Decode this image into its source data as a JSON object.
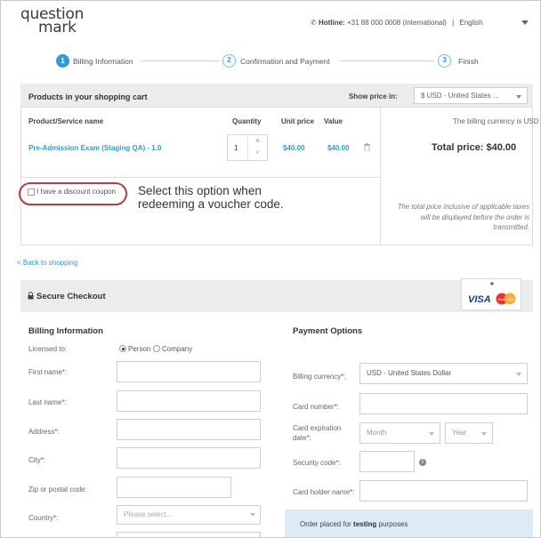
{
  "header": {
    "logo_line1": "question",
    "logo_line2": "mark",
    "hotline_label": "Hotline:",
    "hotline_number": "+31 88 000 0008 (International)",
    "separator": "|",
    "language": "English"
  },
  "steps": [
    {
      "number": "1",
      "label": "Billing Information"
    },
    {
      "number": "2",
      "label": "Confirmation and Payment"
    },
    {
      "number": "3",
      "label": "Finish"
    }
  ],
  "cart": {
    "title": "Products in your shopping cart",
    "show_price_label": "Show price in:",
    "currency_select": "$ USD - United States ...",
    "columns": {
      "product": "Product/Service name",
      "quantity": "Quantity",
      "unit_price": "Unit price",
      "value": "Value"
    },
    "item": {
      "name": "Pre-Admission Exam (Staging QA) - 1.0",
      "quantity": "1",
      "unit_price": "$40.00",
      "value": "$40.00"
    },
    "billing_currency_note": "The billing currency is USD ($)",
    "total_price": "Total price: $40.00",
    "coupon_label": "I have a discount coupon",
    "annotation": "Select this option when redeeming a voucher code.",
    "tax_note": "The total price inclusive of applicable taxes will be displayed before the order is transmitted."
  },
  "back_link": "< Back to shopping",
  "checkout": {
    "title": "Secure Checkout",
    "card_logos": {
      "visa": "VISA",
      "mastercard": "MasterCard"
    }
  },
  "billing": {
    "heading": "Billing Information",
    "licensed_to": "Licensed to:",
    "person": "Person",
    "company": "Company",
    "first_name": "First name*:",
    "last_name": "Last name*:",
    "address": "Address*:",
    "city": "City*:",
    "zip": "Zip or postal code:",
    "country": "Country*:",
    "country_placeholder": "Please select..."
  },
  "payment": {
    "heading": "Payment Options",
    "billing_currency": "Billing currency*:",
    "billing_currency_value": "USD - United States Dollar",
    "card_number": "Card number*:",
    "card_expiration": "Card expiration date*:",
    "month": "Month",
    "year": "Year",
    "security_code": "Security code*:",
    "card_holder": "Card holder name*:",
    "order_text_prefix": "Order placed for",
    "order_text_bold": "testing",
    "order_text_suffix": "purposes"
  },
  "colors": {
    "accent": "#2f9ad8",
    "annotation_oval": "#b24040",
    "bar_bg": "#ececec",
    "info_bg": "#dcebf6"
  }
}
